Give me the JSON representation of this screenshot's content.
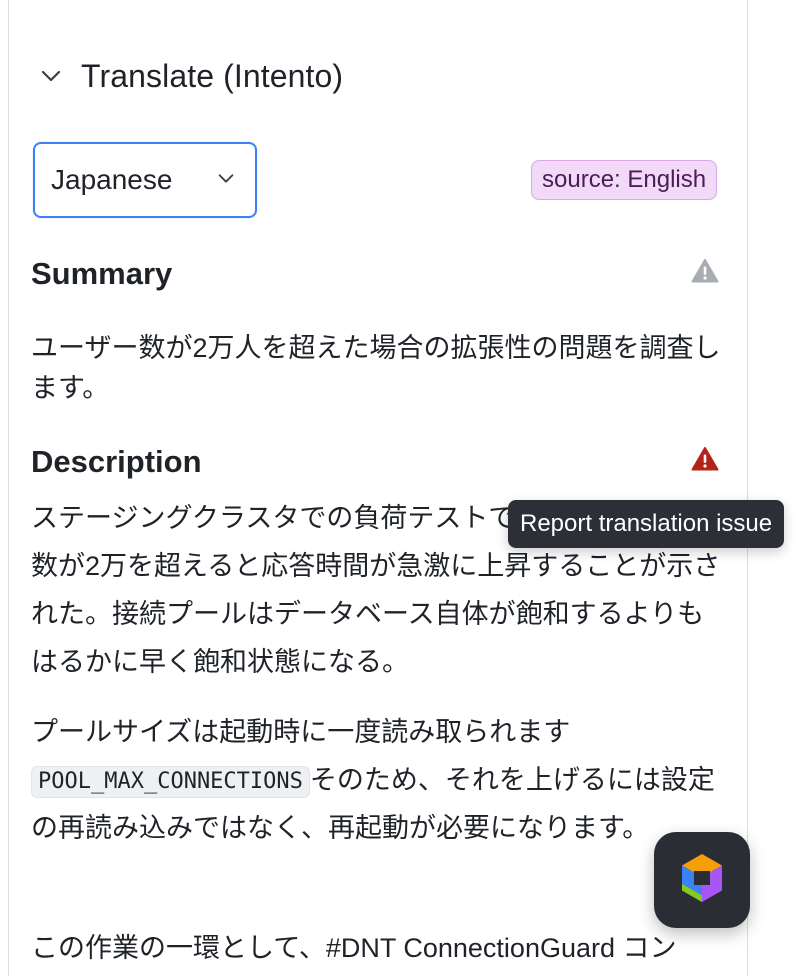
{
  "panel": {
    "title": "Translate (Intento)"
  },
  "language_select": {
    "selected": "Japanese"
  },
  "source_badge": "source: English",
  "summary": {
    "title": "Summary",
    "text": "ユーザー数が2万人を超えた場合の拡張性の問題を調査します。"
  },
  "description": {
    "title": "Description",
    "paragraph1": "ステージングクラスタでの負荷テストでは、セッション数が2万を超えると応答時間が急激に上昇することが示された。接続プールはデータベース自体が飽和するよりもはるかに早く飽和状態になる。",
    "paragraph2_before": "プールサイズは起動時に一度読み取られます",
    "paragraph2_code": "POOL_MAX_CONNECTIONS",
    "paragraph2_after": "そのため、それを上げるには設定の再読み込みではなく、再起動が必要になります。",
    "paragraph3": "この作業の一環として、#DNT ConnectionGuard コン"
  },
  "tooltip": {
    "text": "Report translation issue"
  },
  "colors": {
    "accent": "#3b82f6",
    "badge_bg": "#f2d9f7",
    "warning_gray": "#9ca3af",
    "warning_red": "#b42318",
    "tooltip_bg": "#2c2f35"
  },
  "icons": {
    "collapse": "chevron-down-icon",
    "select": "chevron-down-icon",
    "summary_warning": "warning-triangle-icon",
    "description_warning": "warning-triangle-icon",
    "app": "hexagon-logo-icon"
  }
}
